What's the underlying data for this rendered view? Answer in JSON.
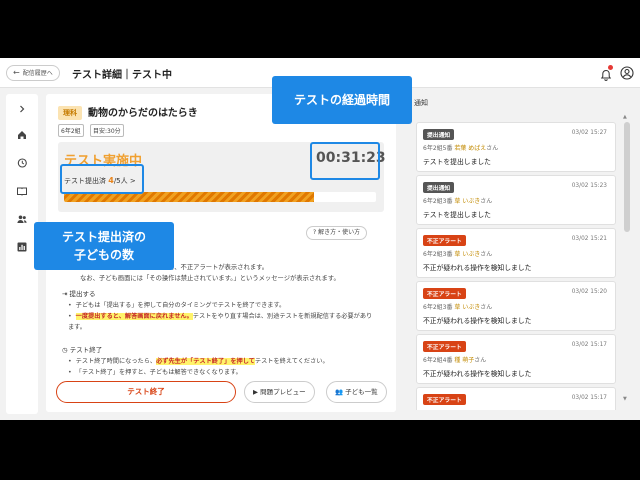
{
  "header": {
    "back_label": "配信履歴へ",
    "title": "テスト詳細｜テスト中"
  },
  "test": {
    "subject": "理科",
    "unit_title": "動物のからだのはたらき",
    "class_tag": "6年2組",
    "time_tag": "目安:30分",
    "status": "テスト実施中",
    "elapsed": "00:31:23",
    "submitted_label": "テスト提出済",
    "submitted_count": "4",
    "total_label": "/5人",
    "progress_fraction": 0.8,
    "help_label": "解き方・使い方"
  },
  "instructions": {
    "warning_line1": "のサイズを変更しようとした場合、不正アラートが表示されます。",
    "warning_line2": "なお、子ども画面には「その操作は禁止されています。」というメッセージが表示されます。",
    "submit_heading": "提出する",
    "submit_bullet1": "子どもは「提出する」を押して自分のタイミングでテストを終了できます。",
    "submit_bullet2_hl": "一度提出すると、解答画面に戻れません。",
    "submit_bullet2_rest": "テストをやり直す場合は、別途テストを新規配信する必要があります。",
    "end_heading": "テスト終了",
    "end_bullet1_pre": "テスト終了時間になったら、",
    "end_bullet1_hl": "必ず先生が「テスト終了」を押して",
    "end_bullet1_post": "テストを終えてください。",
    "end_bullet2": "「テスト終了」を押すと、子どもは解答できなくなります。"
  },
  "actions": {
    "end_test": "テスト終了",
    "preview": "問題プレビュー",
    "students": "子ども一覧"
  },
  "notifications": {
    "title": "通知",
    "items": [
      {
        "type": "提出通知",
        "color": "#555555",
        "time": "03/02 15:27",
        "student_pre": "6年2組5番",
        "student_name": "若葉 めばえ",
        "student_suffix": "さん",
        "message": "テストを提出しました"
      },
      {
        "type": "提出通知",
        "color": "#555555",
        "time": "03/02 15:23",
        "student_pre": "6年2組3番",
        "student_name": "草 いぶき",
        "student_suffix": "さん",
        "message": "テストを提出しました"
      },
      {
        "type": "不正アラート",
        "color": "#d84315",
        "time": "03/02 15:21",
        "student_pre": "6年2組3番",
        "student_name": "草 いぶき",
        "student_suffix": "さん",
        "message": "不正が疑われる操作を検知しました"
      },
      {
        "type": "不正アラート",
        "color": "#d84315",
        "time": "03/02 15:20",
        "student_pre": "6年2組3番",
        "student_name": "草 いぶき",
        "student_suffix": "さん",
        "message": "不正が疑われる操作を検知しました"
      },
      {
        "type": "不正アラート",
        "color": "#d84315",
        "time": "03/02 15:17",
        "student_pre": "6年2組4番",
        "student_name": "種 萌子",
        "student_suffix": "さん",
        "message": "不正が疑われる操作を検知しました"
      },
      {
        "type": "不正アラート",
        "color": "#d84315",
        "time": "03/02 15:17",
        "student_pre": "",
        "student_name": "",
        "student_suffix": "",
        "message": ""
      }
    ]
  },
  "callouts": {
    "elapsed": "テストの経過時間",
    "count_line1": "テスト提出済の",
    "count_line2": "子どもの数"
  }
}
